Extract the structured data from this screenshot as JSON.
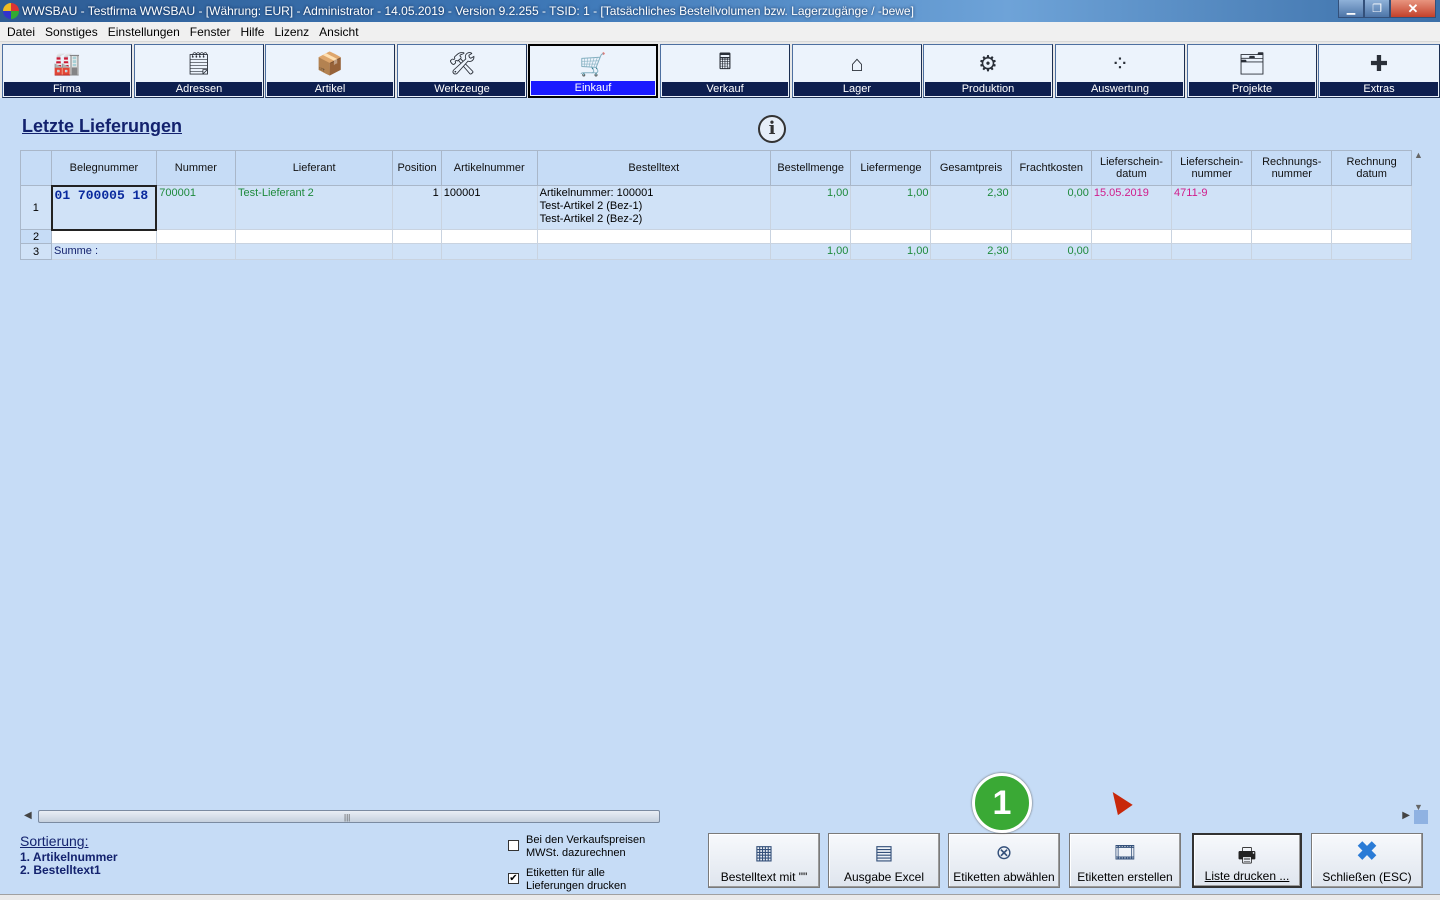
{
  "window": {
    "title": "WWSBAU - Testfirma WWSBAU - [Währung: EUR] - Administrator - 14.05.2019 - Version 9.2.255 - TSID: 1 - [Tatsächliches Bestellvolumen bzw. Lagerzugänge / -bewe]"
  },
  "menu": [
    "Datei",
    "Sonstiges",
    "Einstellungen",
    "Fenster",
    "Hilfe",
    "Lizenz",
    "Ansicht"
  ],
  "toolbar": [
    {
      "label": "Firma",
      "icon": "factory-icon",
      "glyph": "🏭"
    },
    {
      "label": "Adressen",
      "icon": "address-card-icon",
      "glyph": "🗒"
    },
    {
      "label": "Artikel",
      "icon": "package-icon",
      "glyph": "📦"
    },
    {
      "label": "Werkzeuge",
      "icon": "tools-icon",
      "glyph": "🛠"
    },
    {
      "label": "Einkauf",
      "icon": "shopping-cart-icon",
      "glyph": "🛒",
      "active": true
    },
    {
      "label": "Verkauf",
      "icon": "cash-register-icon",
      "glyph": "🖩"
    },
    {
      "label": "Lager",
      "icon": "warehouse-icon",
      "glyph": "⌂"
    },
    {
      "label": "Produktion",
      "icon": "production-icon",
      "glyph": "⚙"
    },
    {
      "label": "Auswertung",
      "icon": "chart-icon",
      "glyph": "⁘"
    },
    {
      "label": "Projekte",
      "icon": "folder-icon",
      "glyph": "🗂"
    },
    {
      "label": "Extras",
      "icon": "puzzle-icon",
      "glyph": "✚"
    }
  ],
  "page": {
    "title": "Letzte Lieferungen"
  },
  "table": {
    "columns": [
      "Belegnummer",
      "Nummer",
      "Lieferant",
      "Position",
      "Artikelnummer",
      "Bestelltext",
      "Bestellmenge",
      "Liefermenge",
      "Gesamtpreis",
      "Frachtkosten",
      "Lieferschein-\ndatum",
      "Lieferschein-\nnummer",
      "Rechnungs-\nnummer",
      "Rechnung\ndatum"
    ],
    "rows": [
      {
        "row_number": "1",
        "belegnummer": "01 700005 18",
        "nummer": "700001",
        "lieferant": "Test-Lieferant 2",
        "position": "1",
        "artikelnummer": "100001",
        "bestelltext_1": "Artikelnummer: 100001",
        "bestelltext_2": "Test-Artikel 2  (Bez-1)",
        "bestelltext_3": "Test-Artikel 2  (Bez-2)",
        "bestellmenge": "1,00",
        "liefermenge": "1,00",
        "gesamtpreis": "2,30",
        "frachtkosten": "0,00",
        "lieferschein_datum": "15.05.2019",
        "lieferschein_nummer": "4711-9"
      },
      {
        "row_number": "2"
      },
      {
        "row_number": "3",
        "label": "Summe :",
        "bestellmenge": "1,00",
        "liefermenge": "1,00",
        "gesamtpreis": "2,30",
        "frachtkosten": "0,00"
      }
    ]
  },
  "sorting": {
    "title": "Sortierung:",
    "items": [
      "1. Artikelnummer",
      "2. Bestelltext1"
    ]
  },
  "options": {
    "vk_mwst": {
      "label_1": "Bei den Verkaufspreisen",
      "label_2": "MWSt. dazurechnen",
      "checked": false
    },
    "etiketten_alle": {
      "label_1": "Etiketten für alle",
      "label_2": "Lieferungen drucken",
      "checked": true,
      "mark": "✔"
    }
  },
  "buttons": {
    "bestelltext": "Bestelltext mit \"\"",
    "excel": "Ausgabe Excel",
    "etiketten_abwaehlen": "Etiketten abwählen",
    "etiketten_erstellen": "Etiketten erstellen",
    "liste_drucken": "Liste drucken ...",
    "schliessen": "Schließen (ESC)"
  },
  "annotation": {
    "badge": "1"
  }
}
